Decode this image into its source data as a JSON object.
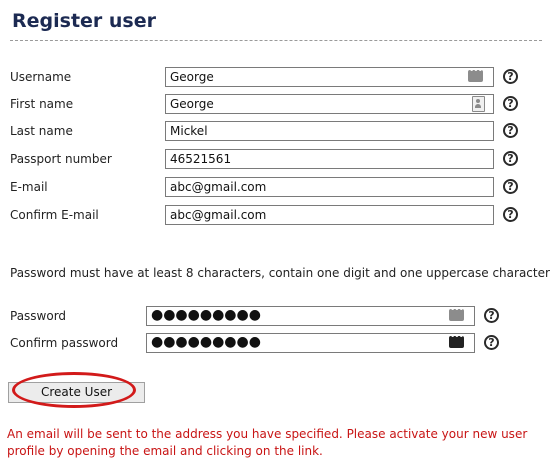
{
  "page": {
    "title": "Register user"
  },
  "fields": [
    {
      "label": "Username",
      "value": "George",
      "icon": "password-manager-icon"
    },
    {
      "label": "First name",
      "value": "George",
      "icon": "contact-card-icon"
    },
    {
      "label": "Last name",
      "value": "Mickel"
    },
    {
      "label": "Passport number",
      "value": "46521561"
    },
    {
      "label": "E-mail",
      "value": "abc@gmail.com"
    },
    {
      "label": "Confirm E-mail",
      "value": "abc@gmail.com"
    }
  ],
  "password_note": "Password must have at least 8 characters, contain one digit and one uppercase character.",
  "password_fields": [
    {
      "label": "Password",
      "value": "●●●●●●●●●",
      "icon": "password-manager-icon"
    },
    {
      "label": "Confirm password",
      "value": "●●●●●●●●●",
      "icon": "password-manager-icon"
    }
  ],
  "help_symbol": "?",
  "create_button": {
    "label": "Create User"
  },
  "info_message": "An email will be sent to the address you have specified. Please activate your new user profile by opening the email and clicking on the link.",
  "colors": {
    "title": "#1c2a52",
    "info_text": "#c81414",
    "highlight_ellipse": "#d21a1a"
  }
}
